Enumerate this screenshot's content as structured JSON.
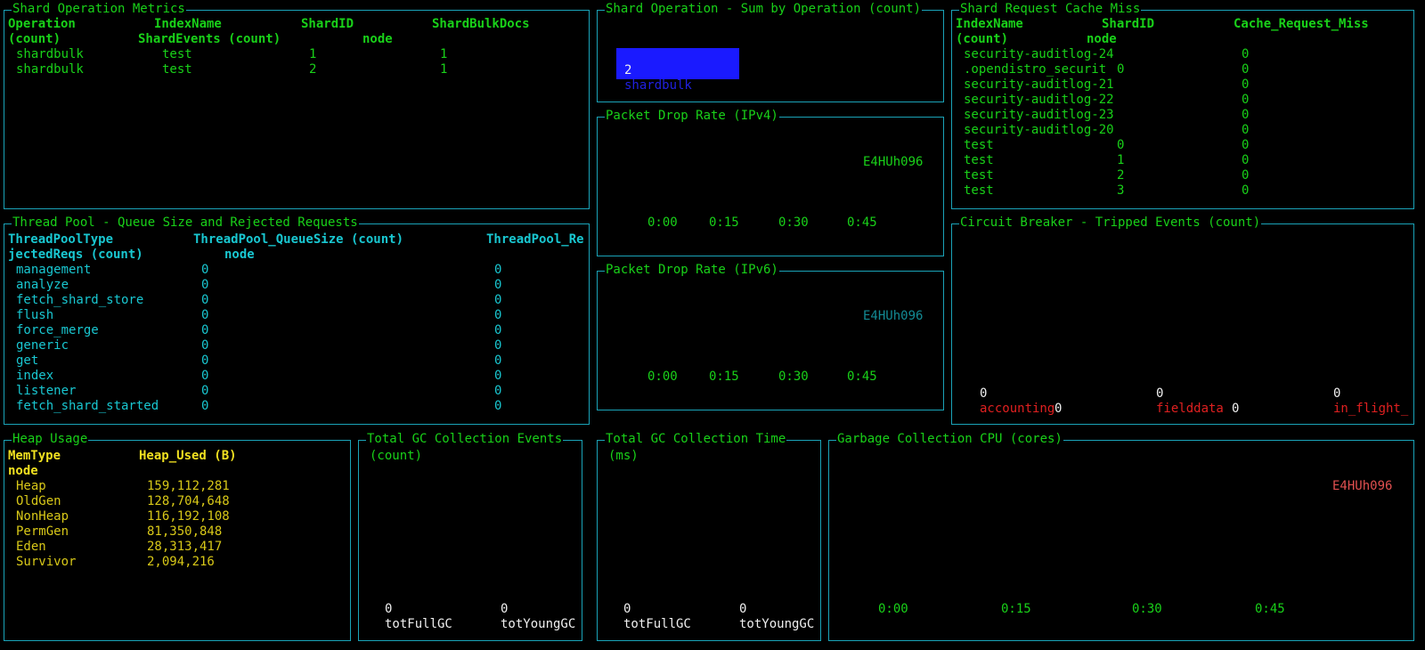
{
  "shard_ops": {
    "title": "Shard Operation Metrics",
    "header": [
      "Operation",
      "IndexName",
      "ShardID",
      "ShardBulkDocs"
    ],
    "header2": [
      "(count)",
      "ShardEvents (count)",
      "node"
    ],
    "rows": [
      [
        "shardbulk",
        "test",
        "1",
        "1"
      ],
      [
        "shardbulk",
        "test",
        "2",
        "1"
      ]
    ]
  },
  "shard_sum": {
    "title": "Shard Operation - Sum by Operation (count)",
    "chart_data": {
      "type": "bar",
      "categories": [
        "shardbulk"
      ],
      "values": [
        2
      ],
      "title": "Shard Operation - Sum by Operation (count)"
    }
  },
  "packet_ipv4": {
    "title": "Packet Drop Rate (IPv4)",
    "legend": "E4HUh096",
    "ticks": [
      "0:00",
      "0:15",
      "0:30",
      "0:45"
    ]
  },
  "packet_ipv6": {
    "title": "Packet Drop Rate (IPv6)",
    "legend": "E4HUh096",
    "ticks": [
      "0:00",
      "0:15",
      "0:30",
      "0:45"
    ]
  },
  "cache_miss": {
    "title": "Shard Request Cache Miss",
    "header": [
      "IndexName",
      "ShardID",
      "Cache_Request_Miss"
    ],
    "header2": [
      "(count)",
      "node"
    ],
    "rows": [
      [
        "security-auditlog-24",
        "",
        "0"
      ],
      [
        ".opendistro_securit",
        "0",
        "0"
      ],
      [
        "security-auditlog-21",
        "",
        "0"
      ],
      [
        "security-auditlog-22",
        "",
        "0"
      ],
      [
        "security-auditlog-23",
        "",
        "0"
      ],
      [
        "security-auditlog-20",
        "",
        "0"
      ],
      [
        "test",
        "0",
        "0"
      ],
      [
        "test",
        "1",
        "0"
      ],
      [
        "test",
        "2",
        "0"
      ],
      [
        "test",
        "3",
        "0"
      ]
    ]
  },
  "thread_pool": {
    "title": "Thread Pool - Queue Size and Rejected Requests",
    "header": [
      "ThreadPoolType",
      "ThreadPool_QueueSize (count)",
      "ThreadPool_Re"
    ],
    "header2": [
      "jectedReqs (count)",
      "node"
    ],
    "rows": [
      [
        "management",
        "0",
        "0"
      ],
      [
        "analyze",
        "0",
        "0"
      ],
      [
        "fetch_shard_store",
        "0",
        "0"
      ],
      [
        "flush",
        "0",
        "0"
      ],
      [
        "force_merge",
        "0",
        "0"
      ],
      [
        "generic",
        "0",
        "0"
      ],
      [
        "get",
        "0",
        "0"
      ],
      [
        "index",
        "0",
        "0"
      ],
      [
        "listener",
        "0",
        "0"
      ],
      [
        "fetch_shard_started",
        "0",
        "0"
      ]
    ]
  },
  "circuit_breaker": {
    "title": "Circuit Breaker - Tripped Events (count)",
    "bars": [
      {
        "value": "0",
        "label": "accounting",
        "trail": "0"
      },
      {
        "value": "0",
        "label": "fielddata",
        "trail": "0"
      },
      {
        "value": "0",
        "label": "in_flight_",
        "trail": ""
      }
    ]
  },
  "heap": {
    "title": "Heap Usage",
    "header": [
      "MemType",
      "Heap_Used (B)"
    ],
    "header2": [
      "node"
    ],
    "rows": [
      [
        "Heap",
        "159,112,281"
      ],
      [
        "OldGen",
        "128,704,648"
      ],
      [
        "NonHeap",
        "116,192,108"
      ],
      [
        "PermGen",
        "81,350,848"
      ],
      [
        "Eden",
        "28,313,417"
      ],
      [
        "Survivor",
        "2,094,216"
      ]
    ]
  },
  "gc_events": {
    "title": "Total GC Collection Events",
    "subtitle": "(count)",
    "bars": [
      {
        "value": "0",
        "label": "totFullGC"
      },
      {
        "value": "0",
        "label": "totYoungGC"
      }
    ]
  },
  "gc_time": {
    "title": "Total GC Collection Time",
    "subtitle": "(ms)",
    "bars": [
      {
        "value": "0",
        "label": "totFullGC"
      },
      {
        "value": "0",
        "label": "totYoungGC"
      }
    ]
  },
  "gc_cpu": {
    "title": "Garbage Collection CPU (cores)",
    "legend": "E4HUh096",
    "ticks": [
      "0:00",
      "0:15",
      "0:30",
      "0:45"
    ]
  },
  "colors": {
    "border": "#1aa3b8",
    "green": "#19d119",
    "cyan": "#19c7d1",
    "yellow": "#d8c818",
    "red": "#e02020",
    "bar_blue": "#1a1aff"
  }
}
